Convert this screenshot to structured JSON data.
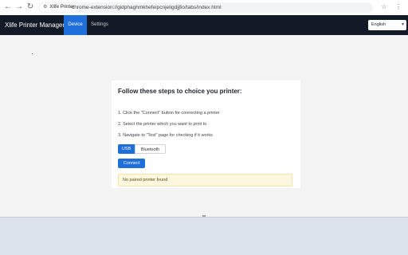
{
  "browser": {
    "site_chip": "Xlife Printer",
    "url": "chrome-extension://gidphaghmkhefeipcnjeligdjjfio/tabs/index.html",
    "nav_icons": [
      "back-icon",
      "forward-icon",
      "reload-icon"
    ],
    "right_icons": [
      "star-icon",
      "menu-icon"
    ]
  },
  "app": {
    "brand": "Xlife Printer Manager",
    "tabs": [
      {
        "label": "Device",
        "active": true
      },
      {
        "label": "Settings",
        "active": false
      }
    ],
    "language": "English",
    "accent_color": "#1e6fd9",
    "nav_background": "#121a27"
  },
  "card": {
    "title": "Follow these steps to choice you printer:",
    "steps": [
      "1. Click the \"Connect\" button for connecting a printer",
      "2. Select the printer which you want to print to",
      "3. Navigate to \"Test\" page for checking if it works"
    ],
    "connection_types": [
      {
        "label": "USB",
        "selected": true
      },
      {
        "label": "Bluetooth",
        "selected": false
      }
    ],
    "connect_label": "Connect",
    "status_message": "No paired printer found"
  }
}
